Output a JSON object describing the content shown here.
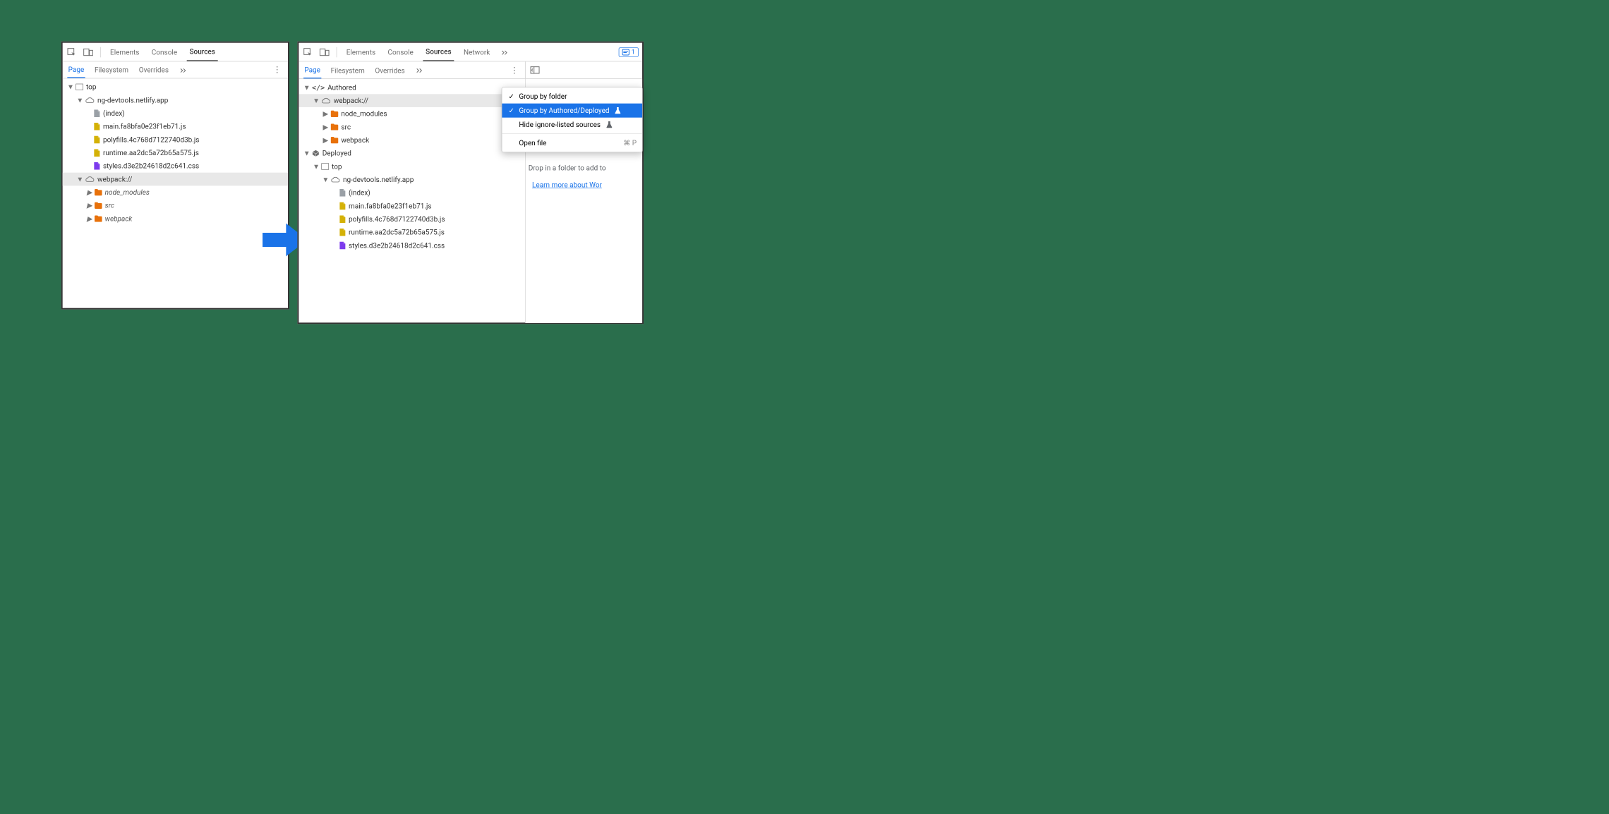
{
  "tabs": {
    "elements": "Elements",
    "console": "Console",
    "sources": "Sources",
    "network": "Network"
  },
  "subtabs": {
    "page": "Page",
    "filesystem": "Filesystem",
    "overrides": "Overrides"
  },
  "left_tree": {
    "top": "top",
    "domain": "ng-devtools.netlify.app",
    "index": "(index)",
    "files": [
      "main.fa8bfa0e23f1eb71.js",
      "polyfills.4c768d7122740d3b.js",
      "runtime.aa2dc5a72b65a575.js",
      "styles.d3e2b24618d2c641.css"
    ],
    "webpack": "webpack://",
    "folders": [
      "node_modules",
      "src",
      "webpack"
    ]
  },
  "right_tree": {
    "authored": "Authored",
    "webpack": "webpack://",
    "folders": [
      "node_modules",
      "src",
      "webpack"
    ],
    "deployed": "Deployed",
    "top": "top",
    "domain": "ng-devtools.netlify.app",
    "index": "(index)",
    "files": [
      "main.fa8bfa0e23f1eb71.js",
      "polyfills.4c768d7122740d3b.js",
      "runtime.aa2dc5a72b65a575.js",
      "styles.d3e2b24618d2c641.css"
    ]
  },
  "menu": {
    "group_folder": "Group by folder",
    "group_authored": "Group by Authored/Deployed",
    "hide_ignore": "Hide ignore-listed sources",
    "open_file": "Open file",
    "open_shortcut": "⌘ P"
  },
  "issues_count": "1",
  "hint": {
    "drop": "Drop in a folder to add to",
    "learn": "Learn more about Wor"
  }
}
